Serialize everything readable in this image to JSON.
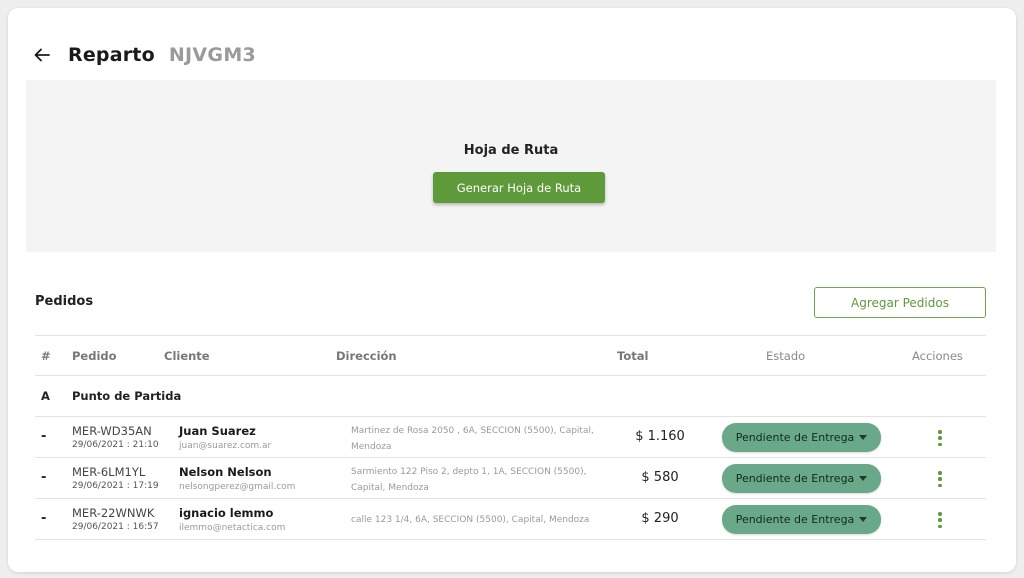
{
  "header": {
    "title": "Reparto",
    "code": "NJVGM3",
    "back_icon": "arrow-left-icon"
  },
  "hoja_de_ruta": {
    "title": "Hoja de Ruta",
    "button_label": "Generar Hoja de Ruta"
  },
  "pedidos": {
    "title": "Pedidos",
    "add_button_label": "Agregar Pedidos",
    "columns": [
      "#",
      "Pedido",
      "Cliente",
      "Dirección",
      "Total",
      "Estado",
      "Acciones"
    ],
    "start_row": {
      "marker": "A",
      "label": "Punto de Partida"
    },
    "rows": [
      {
        "num": "-",
        "pedido": "MER-WD35AN",
        "fecha": "29/06/2021 : 21:10",
        "cliente_nombre": "Juan Suarez",
        "cliente_email": "juan@suarez.com.ar",
        "direccion": "Martinez de Rosa 2050 , 6A, SECCION (5500), Capital, Mendoza",
        "total": "$ 1.160",
        "estado": "Pendiente de Entrega"
      },
      {
        "num": "-",
        "pedido": "MER-6LM1YL",
        "fecha": "29/06/2021 : 17:19",
        "cliente_nombre": "Nelson Nelson",
        "cliente_email": "nelsongperez@gmail.com",
        "direccion": "Sarmiento 122 Piso 2, depto 1, 1A, SECCION (5500), Capital, Mendoza",
        "total": "$ 580",
        "estado": "Pendiente de Entrega"
      },
      {
        "num": "-",
        "pedido": "MER-22WNWK",
        "fecha": "29/06/2021 : 16:57",
        "cliente_nombre": "ignacio lemmo",
        "cliente_email": "ilemmo@netactica.com",
        "direccion": "calle 123 1/4, 6A, SECCION (5500), Capital, Mendoza",
        "total": "$ 290",
        "estado": "Pendiente de Entrega"
      }
    ]
  },
  "colors": {
    "primary_green": "#5e9a3a",
    "estado_pill": "#6aa88a",
    "panel_bg": "#f4f4f4",
    "code_gray": "#9a9a9a"
  }
}
